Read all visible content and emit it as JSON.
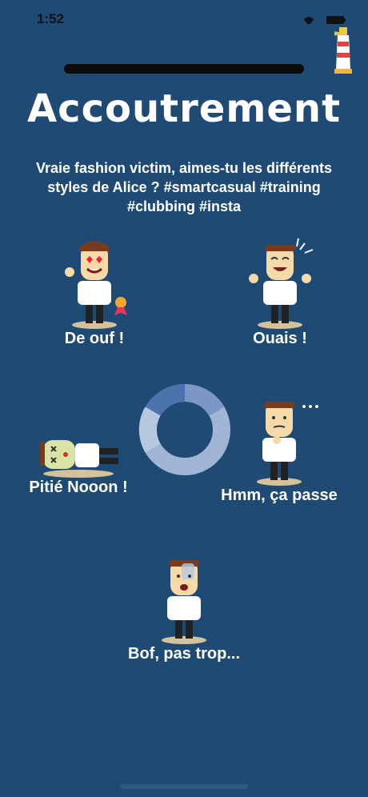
{
  "status_bar": {
    "time": "1:52",
    "icons": [
      "wifi-icon",
      "battery-icon"
    ]
  },
  "header": {
    "title": "Accoutrement",
    "subtitle": "Vraie fashion victim, aimes-tu les différents styles de Alice ? #smartcasual #training #clubbing #insta"
  },
  "ratings": [
    {
      "label": "De ouf !"
    },
    {
      "label": "Ouais !"
    },
    {
      "label": "Pitié Nooon !"
    },
    {
      "label": "Hmm, ça passe"
    },
    {
      "label": "Bof, pas trop..."
    }
  ],
  "colors": {
    "background": "#1e4a73",
    "ring_light": "#b7c8de",
    "ring_mid": "#9fb5d3",
    "ring_dark": "#4c73ad"
  }
}
